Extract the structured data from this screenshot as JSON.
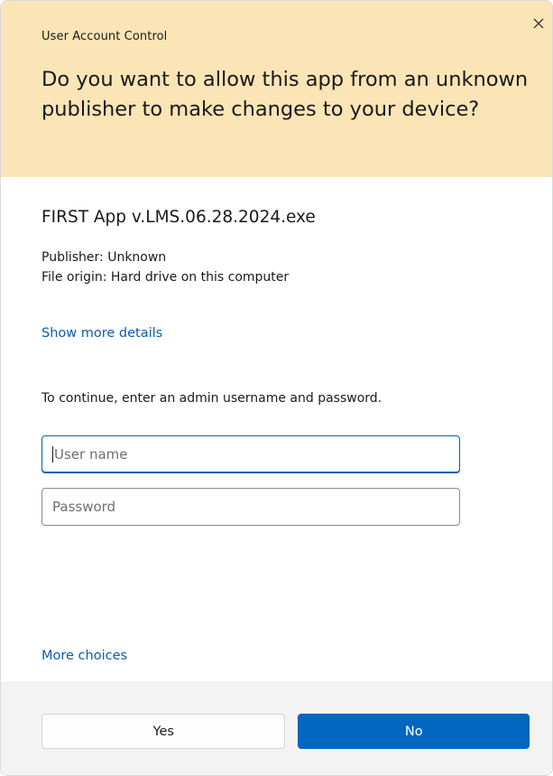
{
  "dialog": {
    "title": "User Account Control",
    "question": "Do you want to allow this app from an unknown publisher to make changes to your device?",
    "close_icon": "close-icon",
    "program_name": "FIRST App v.LMS.06.28.2024.exe",
    "publisher": "Publisher: Unknown",
    "file_origin": "File origin: Hard drive on this computer",
    "show_more_details": "Show more details",
    "instruction": "To continue, enter an admin username and password.",
    "username_placeholder": "User name",
    "password_placeholder": "Password",
    "more_choices": "More choices",
    "yes_label": "Yes",
    "no_label": "No"
  },
  "colors": {
    "header_background": "#fbe5b6",
    "link": "#0b5cad",
    "primary_button": "#0067c0",
    "focus_border": "#005fb8"
  }
}
